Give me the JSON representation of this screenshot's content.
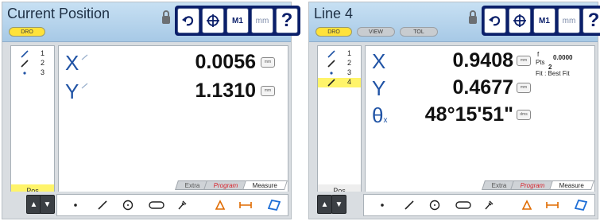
{
  "left": {
    "title": "Current Position",
    "tab_dro": "DRO",
    "toolbar": {
      "m1_label": "M1",
      "mm_label": "mm",
      "help_label": "?"
    },
    "features": [
      {
        "num": "1",
        "icon": "line-icon"
      },
      {
        "num": "2",
        "icon": "line-icon"
      },
      {
        "num": "3",
        "icon": "point-icon"
      }
    ],
    "pos_label": "Pos",
    "rows": [
      {
        "axis": "X",
        "value": "0.0056",
        "unit_btn": "mm"
      },
      {
        "axis": "Y",
        "value": "1.1310",
        "unit_btn": "mm"
      }
    ],
    "tabs": [
      "Extra",
      "Program",
      "Measure"
    ]
  },
  "right": {
    "title": "Line 4",
    "tab_dro": "DRO",
    "tab_view": "VIEW",
    "tab_tol": "TOL",
    "toolbar": {
      "m1_label": "M1",
      "mm_label": "mm",
      "help_label": "?"
    },
    "features": [
      {
        "num": "1",
        "icon": "line-icon"
      },
      {
        "num": "2",
        "icon": "line-icon"
      },
      {
        "num": "3",
        "icon": "point-icon"
      },
      {
        "num": "4",
        "icon": "line-icon"
      }
    ],
    "pos_label": "Pos",
    "rows": [
      {
        "axis": "X",
        "value": "0.9408",
        "unit_btn": "mm"
      },
      {
        "axis": "Y",
        "value": "0.4677",
        "unit_btn": "mm"
      },
      {
        "axis": "θ",
        "axis_sub": "x",
        "value": "48°15'51\"",
        "unit_btn": "dms"
      }
    ],
    "fit_info": {
      "f_label": "f",
      "f_value": "0.0000",
      "pts_label": "Pts",
      "pts_value": "2",
      "fit_text": "Fit : Best Fit"
    },
    "tabs": [
      "Extra",
      "Program",
      "Measure"
    ]
  },
  "bottom_tools": [
    "point-icon",
    "line-icon",
    "circle-icon",
    "slot-icon",
    "probe-icon",
    "angle-icon",
    "distance-icon",
    "skew-icon"
  ],
  "colors": {
    "title_bar": "#a7c9e6",
    "toolbar": "#0b1f6a",
    "axis_blue": "#2053a5",
    "highlight_yellow": "#fff46a",
    "program_red": "#d8222b"
  }
}
